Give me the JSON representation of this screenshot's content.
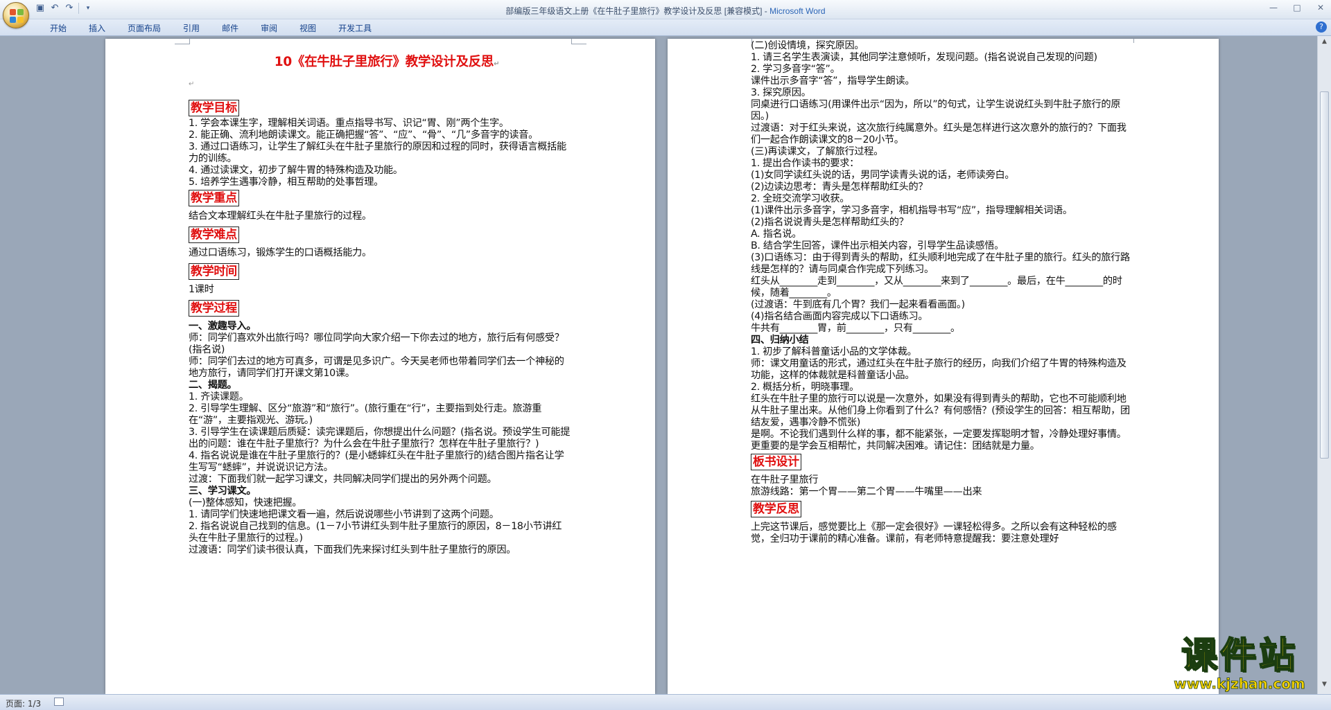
{
  "window": {
    "title_doc": "部编版三年级语文上册《在牛肚子里旅行》教学设计及反思 [兼容模式] - ",
    "title_app": "Microsoft Word"
  },
  "ribbon": {
    "tabs": [
      "开始",
      "插入",
      "页面布局",
      "引用",
      "邮件",
      "审阅",
      "视图",
      "开发工具"
    ]
  },
  "status": {
    "page": "页面: 1/3"
  },
  "page1": {
    "title": "10《在牛肚子里旅行》教学设计及反思",
    "mark": "↵",
    "goals_heading": "教学目标",
    "goals": [
      "1. 学会本课生字，理解相关词语。重点指导书写、识记“胃、刚”两个生字。",
      "2. 能正确、流利地朗读课文。能正确把握“答”、“应”、“骨”、“几”多音字的读音。",
      "3. 通过口语练习，让学生了解红头在牛肚子里旅行的原因和过程的同时，获得语言概括能力的训练。",
      "4. 通过读课文，初步了解牛胃的特殊构造及功能。",
      "5. 培养学生遇事冷静，相互帮助的处事哲理。"
    ],
    "focus_heading": "教学重点",
    "focus": "结合文本理解红头在牛肚子里旅行的过程。",
    "difficulty_heading": "教学难点",
    "difficulty": "通过口语练习，锻炼学生的口语概括能力。",
    "time_heading": "教学时间",
    "time": "1课时",
    "process_heading": "教学过程",
    "process": [
      {
        "b": true,
        "t": "一、激趣导入。"
      },
      {
        "t": "师：同学们喜欢外出旅行吗？哪位同学向大家介绍一下你去过的地方，旅行后有何感受？(指名说)"
      },
      {
        "t": "师：同学们去过的地方可真多，可谓是见多识广。今天吴老师也带着同学们去一个神秘的地方旅行，请同学们打开课文第10课。"
      },
      {
        "b": true,
        "t": "二、揭题。"
      },
      {
        "t": "1. 齐读课题。"
      },
      {
        "t": "2. 引导学生理解、区分“旅游”和“旅行”。(旅行重在“行”，主要指到处行走。旅游重在“游”，主要指观光、游玩。)"
      },
      {
        "t": "3. 引导学生在读课题后质疑：读完课题后，你想提出什么问题？(指名说。预设学生可能提出的问题：谁在牛肚子里旅行？为什么会在牛肚子里旅行？怎样在牛肚子里旅行？)"
      },
      {
        "t": "4. 指名说说是谁在牛肚子里旅行的？(是小蟋蟀红头在牛肚子里旅行的)结合图片指名让学生写写“蟋蟀”，并说说识记方法。"
      },
      {
        "t": "过渡：下面我们就一起学习课文，共同解决同学们提出的另外两个问题。"
      },
      {
        "b": true,
        "t": "三、学习课文。"
      },
      {
        "t": "(一)整体感知，快速把握。"
      },
      {
        "t": "1. 请同学们快速地把课文看一遍，然后说说哪些小节讲到了这两个问题。"
      },
      {
        "t": "2. 指名说说自己找到的信息。(1－7小节讲红头到牛肚子里旅行的原因，8－18小节讲红头在牛肚子里旅行的过程。)"
      },
      {
        "t": "过渡语：同学们读书很认真，下面我们先来探讨红头到牛肚子里旅行的原因。"
      }
    ]
  },
  "page2": {
    "mark": "↵",
    "lines_a": [
      {
        "t": "(二)创设情境，探究原因。"
      },
      {
        "t": "1. 请三名学生表演读，其他同学注意倾听，发现问题。(指名说说自己发现的问题)"
      },
      {
        "t": "2. 学习多音字“答”。"
      },
      {
        "t": "课件出示多音字“答”，指导学生朗读。"
      },
      {
        "t": "3. 探究原因。"
      },
      {
        "t": "同桌进行口语练习(用课件出示“因为，所以”的句式，让学生说说红头到牛肚子旅行的原因。)"
      },
      {
        "t": "过渡语：对于红头来说，这次旅行纯属意外。红头是怎样进行这次意外的旅行的？下面我们一起合作朗读课文的8－20小节。"
      },
      {
        "t": "(三)再读课文，了解旅行过程。"
      },
      {
        "t": "1. 提出合作读书的要求："
      },
      {
        "t": "(1)女同学读红头说的话，男同学读青头说的话，老师读旁白。"
      },
      {
        "t": "(2)边读边思考：青头是怎样帮助红头的？"
      },
      {
        "t": "2. 全班交流学习收获。"
      },
      {
        "t": "(1)课件出示多音字，学习多音字，相机指导书写“应”，指导理解相关词语。"
      },
      {
        "t": "(2)指名说说青头是怎样帮助红头的？"
      },
      {
        "t": "A. 指名说。"
      },
      {
        "t": "B. 结合学生回答，课件出示相关内容，引导学生品读感悟。"
      },
      {
        "t": "(3)口语练习：由于得到青头的帮助，红头顺利地完成了在牛肚子里的旅行。红头的旅行路线是怎样的？请与同桌合作完成下列练习。"
      },
      {
        "t": "红头从________走到________，又从________来到了________。最后，在牛________的时候，随着________。"
      },
      {
        "t": "(过渡语：牛到底有几个胃？我们一起来看看画面。)"
      },
      {
        "t": "(4)指名结合画面内容完成以下口语练习。"
      },
      {
        "t": "牛共有________胃，前________，只有________。"
      },
      {
        "b": true,
        "t": "四、归纳小结"
      },
      {
        "t": "1. 初步了解科普童话小品的文学体裁。"
      },
      {
        "t": "师：课文用童话的形式，通过红头在牛肚子旅行的经历，向我们介绍了牛胃的特殊构造及功能，这样的体裁就是科普童话小品。"
      },
      {
        "t": "2. 概括分析，明晓事理。"
      },
      {
        "t": "红头在牛肚子里的旅行可以说是一次意外，如果没有得到青头的帮助，它也不可能顺利地从牛肚子里出来。从他们身上你看到了什么？有何感悟？(预设学生的回答：相互帮助，团结友爱，遇事冷静不慌张)"
      },
      {
        "t": "是啊。不论我们遇到什么样的事，都不能紧张，一定要发挥聪明才智，冷静处理好事情。更重要的是学会互相帮忙，共同解决困难。请记住：团结就是力量。"
      }
    ],
    "board_heading": "板书设计",
    "board": [
      {
        "t": "在牛肚子里旅行"
      },
      {
        "t": "旅游线路：第一个胃——第二个胃——牛嘴里——出来"
      }
    ],
    "reflect_heading": "教学反思",
    "reflect": "上完这节课后，感觉要比上《那一定会很好》一课轻松得多。之所以会有这种轻松的感觉，全归功于课前的精心准备。课前，有老师特意提醒我：要注意处理好"
  },
  "watermark": {
    "big": "课件站",
    "url": "www.kjzhan.com"
  },
  "colors": {
    "heading_red": "#e01010",
    "watermark_yellow": "#f7d300",
    "app_blue": "#2a64b6"
  }
}
